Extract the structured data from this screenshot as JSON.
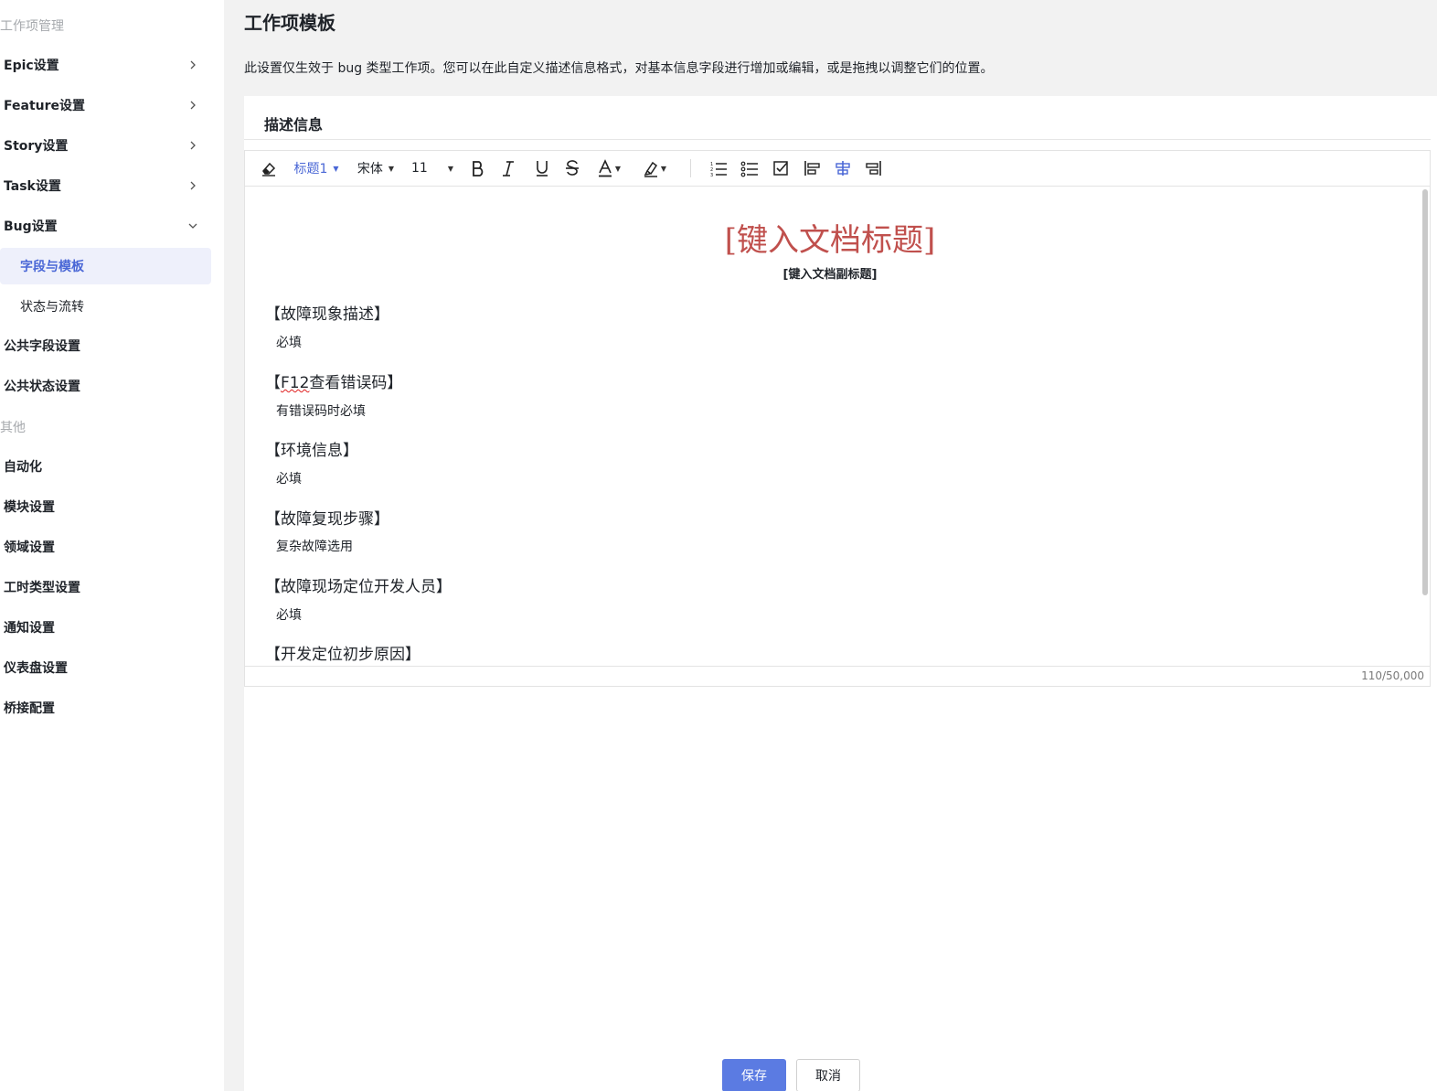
{
  "sidebar": {
    "section_manage": "工作项管理",
    "items": [
      {
        "label": "Epic设置"
      },
      {
        "label": "Feature设置"
      },
      {
        "label": "Story设置"
      },
      {
        "label": "Task设置"
      },
      {
        "label": "Bug设置"
      }
    ],
    "sub_items": [
      {
        "label": "字段与模板",
        "active": true
      },
      {
        "label": "状态与流转",
        "active": false
      }
    ],
    "items2": [
      {
        "label": "公共字段设置"
      },
      {
        "label": "公共状态设置"
      }
    ],
    "section_other": "其他",
    "other_items": [
      {
        "label": "自动化"
      },
      {
        "label": "模块设置"
      },
      {
        "label": "领域设置"
      },
      {
        "label": "工时类型设置"
      },
      {
        "label": "通知设置"
      },
      {
        "label": "仪表盘设置"
      },
      {
        "label": "桥接配置"
      }
    ]
  },
  "header": {
    "title": "工作项模板",
    "description": "此设置仅生效于 bug 类型工作项。您可以在此自定义描述信息格式，对基本信息字段进行增加或编辑，或是拖拽以调整它们的位置。"
  },
  "panel": {
    "heading": "描述信息"
  },
  "toolbar": {
    "heading_style": "标题1",
    "font_family": "宋体",
    "font_size": "11"
  },
  "document": {
    "title": "[键入文档标题]",
    "subtitle": "[键入文档副标题]",
    "sections": [
      {
        "heading": "【故障现象描述】",
        "body": "必填"
      },
      {
        "heading_pre": "【",
        "heading_err": "F12",
        "heading_post": "查看错误码】",
        "body": "有错误码时必填"
      },
      {
        "heading": "【环境信息】",
        "body": "必填"
      },
      {
        "heading": "【故障复现步骤】",
        "body": "复杂故障选用"
      },
      {
        "heading": "【故障现场定位开发人员】",
        "body": "必填"
      },
      {
        "heading": "【开发定位初步原因】"
      }
    ],
    "counter": "110/50,000"
  },
  "actions": {
    "save": "保存",
    "cancel": "取消"
  },
  "colors": {
    "accent": "#5b7be2",
    "active_bg": "#eef0fb",
    "doc_title": "#c0504d"
  }
}
